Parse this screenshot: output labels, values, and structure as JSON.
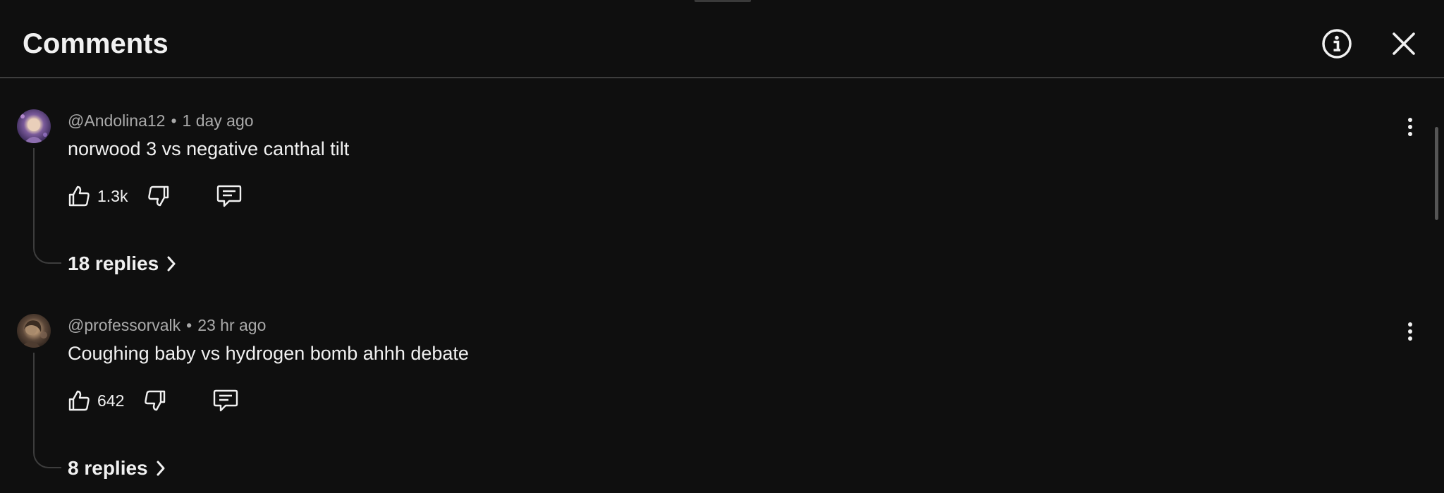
{
  "header": {
    "title": "Comments",
    "info_icon": "info-icon",
    "close_icon": "close-icon"
  },
  "comments": [
    {
      "handle": "@Andolina12",
      "separator": "•",
      "time": "1 day ago",
      "text": "norwood 3 vs negative canthal tilt",
      "likes": "1.3k",
      "replies_label": "18 replies",
      "avatar_colors": [
        "#6a4c8c",
        "#d9b8a0"
      ]
    },
    {
      "handle": "@professorvalk",
      "separator": "•",
      "time": "23 hr ago",
      "text": "Coughing baby vs hydrogen bomb ahhh debate",
      "likes": "642",
      "replies_label": "8 replies",
      "avatar_colors": [
        "#4a3a30",
        "#a08870"
      ]
    }
  ],
  "colors": {
    "background": "#0f0f0f",
    "text": "#f1f1f1",
    "muted": "#aaaaaa",
    "divider": "#3d3d3d"
  }
}
